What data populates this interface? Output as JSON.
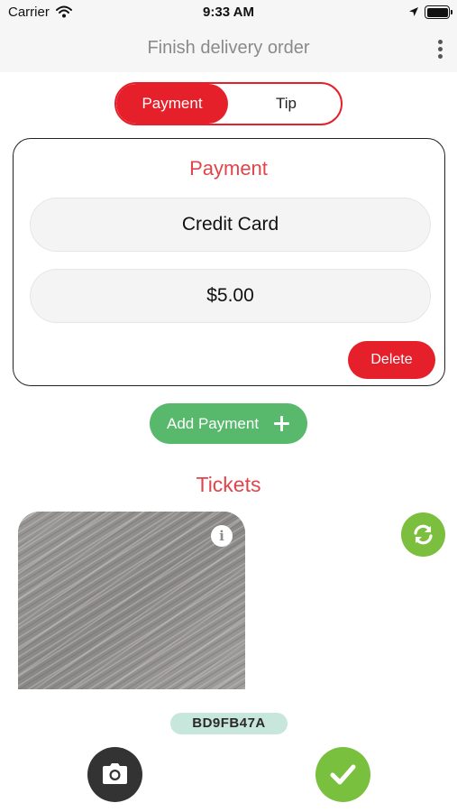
{
  "status_bar": {
    "carrier": "Carrier",
    "time": "9:33 AM",
    "icons": [
      "wifi-icon",
      "location-arrow-icon",
      "battery-icon"
    ]
  },
  "nav": {
    "title": "Finish delivery order",
    "menu_icon": "more-vertical-icon"
  },
  "segmented": {
    "options": [
      "Payment",
      "Tip"
    ],
    "selected": "Payment"
  },
  "payment_card": {
    "title": "Payment",
    "method": "Credit Card",
    "amount": "$5.00",
    "delete_label": "Delete"
  },
  "add_payment": {
    "label": "Add Payment",
    "icon": "plus-icon"
  },
  "tickets": {
    "title": "Tickets",
    "photo": "wood-grain-photo",
    "info_icon_glyph": "i",
    "refresh_icon": "refresh-icon",
    "code": "BD9FB47A"
  },
  "bottom_actions": {
    "camera_icon": "camera-icon",
    "confirm_icon": "checkmark-icon"
  },
  "colors": {
    "accent_red": "#e5202a",
    "title_red": "#e0454b",
    "add_green": "#58b86c",
    "action_green": "#79c03f",
    "badge_mint": "#c8e7dc",
    "dark_button": "#333333"
  }
}
